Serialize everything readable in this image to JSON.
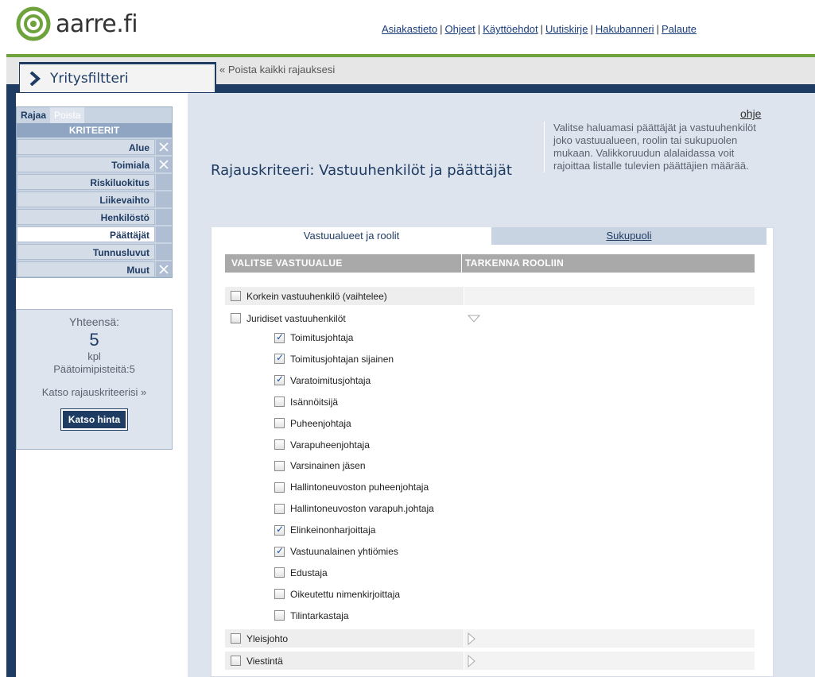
{
  "header": {
    "brand": "aarre.fi",
    "links": [
      "Asiakastieto",
      "Ohjeet",
      "Käyttöehdot",
      "Uutiskirje",
      "Hakubanneri",
      "Palaute"
    ]
  },
  "nav": {
    "active_tab": "Yritysfiltteri",
    "reset_link": "« Poista kaikki rajauksesi"
  },
  "filter": {
    "tab_limit": "Rajaa",
    "tab_remove": "Poista",
    "criteria_heading": "KRITEERIT",
    "items": [
      {
        "label": "Alue",
        "removable": true
      },
      {
        "label": "Toimiala",
        "removable": true
      },
      {
        "label": "Riskiluokitus",
        "removable": false
      },
      {
        "label": "Liikevaihto",
        "removable": false
      },
      {
        "label": "Henkilöstö",
        "removable": false
      },
      {
        "label": "Päättäjät",
        "removable": false,
        "selected": true
      },
      {
        "label": "Tunnusluvut",
        "removable": false
      },
      {
        "label": "Muut",
        "removable": true
      }
    ]
  },
  "summary": {
    "total_label": "Yhteensä:",
    "count": "5",
    "unit": "kpl",
    "hq": "Päätoimipisteitä:5",
    "criteria_link": "Katso rajauskriteerisi »",
    "price_button": "Katso hinta"
  },
  "main": {
    "help_link": "ohje",
    "title": "Rajauskriteeri: Vastuuhenkilöt ja päättäjät",
    "help_text": "Valitse haluamasi päättäjät ja vastuuhenkilöt joko vastuualueen, roolin tai sukupuolen mukaan. Valikkoruudun alalaidassa voit rajoittaa listalle tulevien päättäjien määrää.",
    "tab_roles": "Vastuualueet ja roolit",
    "tab_gender": "Sukupuoli",
    "col_area": "VALITSE VASTUUALUE",
    "col_role": "TARKENNA ROOLIIN",
    "areas": [
      {
        "label": "Korkein vastuuhenkilö (vaihtelee)",
        "checked": false
      },
      {
        "label": "Juridiset vastuuhenkilöt",
        "checked": false
      },
      {
        "label": "Yleisjohto",
        "checked": false
      },
      {
        "label": "Viestintä",
        "checked": false
      }
    ],
    "roles": [
      {
        "label": "Toimitusjohtaja",
        "checked": true
      },
      {
        "label": "Toimitusjohtajan sijainen",
        "checked": true
      },
      {
        "label": "Varatoimitusjohtaja",
        "checked": true
      },
      {
        "label": "Isännöitsijä",
        "checked": false
      },
      {
        "label": "Puheenjohtaja",
        "checked": false
      },
      {
        "label": "Varapuheenjohtaja",
        "checked": false
      },
      {
        "label": "Varsinainen jäsen",
        "checked": false
      },
      {
        "label": "Hallintoneuvoston puheenjohtaja",
        "checked": false
      },
      {
        "label": "Hallintoneuvoston varapuh.johtaja",
        "checked": false
      },
      {
        "label": "Elinkeinonharjoittaja",
        "checked": true
      },
      {
        "label": "Vastuunalainen yhtiömies",
        "checked": true
      },
      {
        "label": "Edustaja",
        "checked": false
      },
      {
        "label": "Oikeutettu nimenkirjoittaja",
        "checked": false
      },
      {
        "label": "Tilintarkastaja",
        "checked": false
      }
    ]
  },
  "colors": {
    "navy": "#1f3c63",
    "green": "#6ea23d",
    "panel": "#dde4ee"
  }
}
